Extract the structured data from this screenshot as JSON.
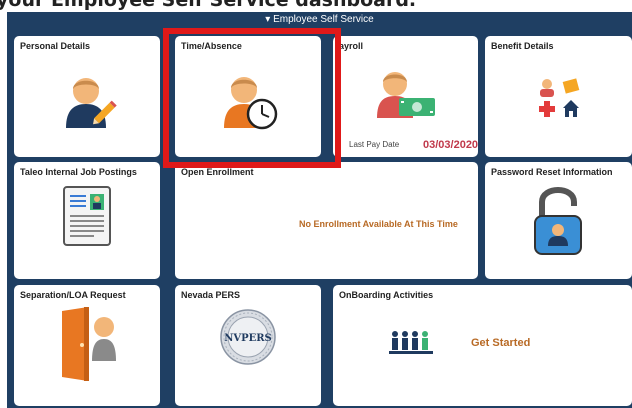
{
  "caption": "your Employee Self Service dashboard.",
  "header": {
    "title": "▾ Employee Self Service"
  },
  "tiles": {
    "personal_details": {
      "title": "Personal Details"
    },
    "time_absence": {
      "title": "Time/Absence"
    },
    "payroll": {
      "title": "ayroll",
      "pay_date_label": "Last Pay Date",
      "pay_date_value": "03/03/2020"
    },
    "benefit_details": {
      "title": "Benefit Details"
    },
    "taleo": {
      "title": "Taleo Internal Job Postings"
    },
    "open_enrollment": {
      "title": "Open Enrollment",
      "message": "No Enrollment Available At This Time"
    },
    "password_reset": {
      "title": "Password Reset Information"
    },
    "separation": {
      "title": "Separation/LOA Request"
    },
    "nevada_pers": {
      "title": "Nevada PERS",
      "seal_text": "NVPERS"
    },
    "onboarding": {
      "title": "OnBoarding Activities",
      "action": "Get Started"
    }
  },
  "colors": {
    "shell": "#1f3f63",
    "highlight": "#e01919",
    "accent_orange": "#b86a25",
    "date_red": "#c0394b"
  }
}
